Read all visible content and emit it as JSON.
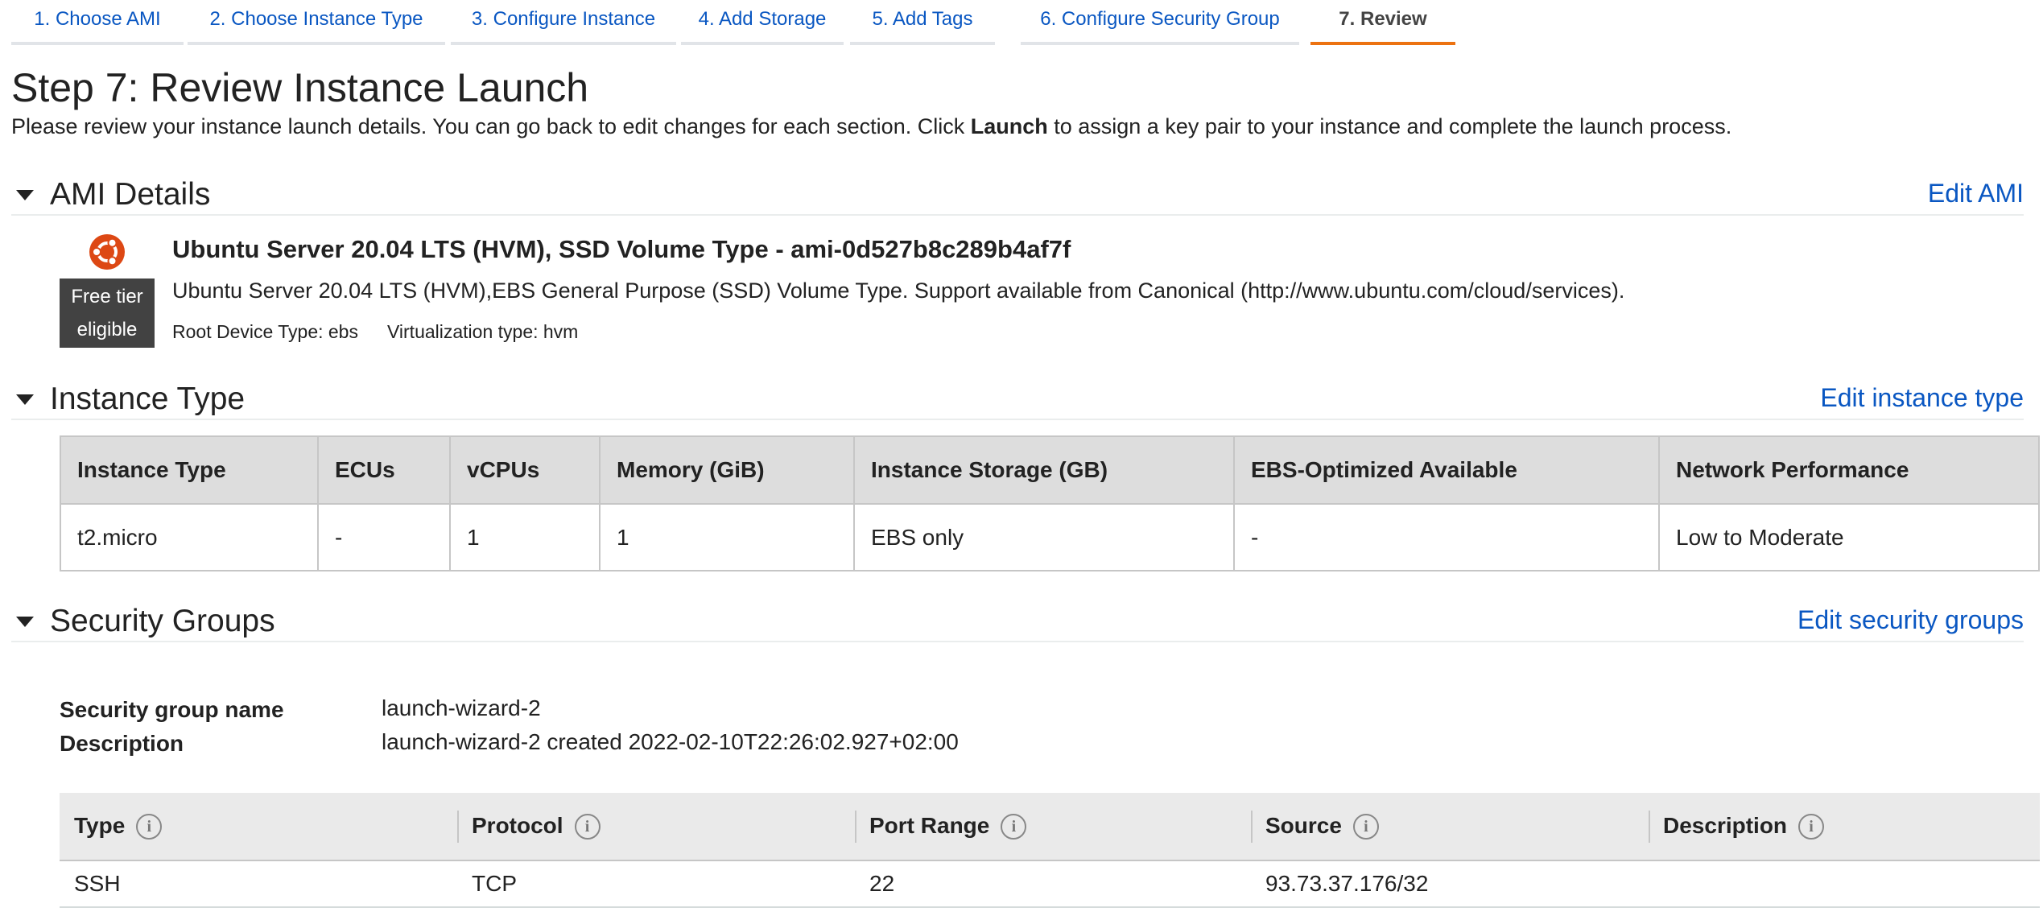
{
  "tabs": [
    {
      "label": "1. Choose AMI"
    },
    {
      "label": "2. Choose Instance Type"
    },
    {
      "label": "3. Configure Instance"
    },
    {
      "label": "4. Add Storage"
    },
    {
      "label": "5. Add Tags"
    },
    {
      "label": "6. Configure Security Group"
    },
    {
      "label": "7. Review",
      "active": true
    }
  ],
  "page": {
    "title": "Step 7: Review Instance Launch",
    "intro_before": "Please review your instance launch details. You can go back to edit changes for each section. Click ",
    "intro_bold": "Launch",
    "intro_after": " to assign a key pair to your instance and complete the launch process."
  },
  "ami": {
    "section_title": "AMI Details",
    "edit_label": "Edit AMI",
    "logo_icon": "ubuntu-logo-icon",
    "badge_line1": "Free tier",
    "badge_line2": "eligible",
    "name": "Ubuntu Server 20.04 LTS (HVM), SSD Volume Type - ami-0d527b8c289b4af7f",
    "description": "Ubuntu Server 20.04 LTS (HVM),EBS General Purpose (SSD) Volume Type. Support available from Canonical (http://www.ubuntu.com/cloud/services).",
    "root_device": "Root Device Type: ebs",
    "virtualization": "Virtualization type: hvm"
  },
  "instance_type": {
    "section_title": "Instance Type",
    "edit_label": "Edit instance type",
    "columns": [
      "Instance Type",
      "ECUs",
      "vCPUs",
      "Memory (GiB)",
      "Instance Storage (GB)",
      "EBS-Optimized Available",
      "Network Performance"
    ],
    "row": [
      "t2.micro",
      "-",
      "1",
      "1",
      "EBS only",
      "-",
      "Low to Moderate"
    ]
  },
  "security_groups": {
    "section_title": "Security Groups",
    "edit_label": "Edit security groups",
    "name_label": "Security group name",
    "name_value": "launch-wizard-2",
    "desc_label": "Description",
    "desc_value": "launch-wizard-2 created 2022-02-10T22:26:02.927+02:00",
    "columns": [
      "Type",
      "Protocol",
      "Port Range",
      "Source",
      "Description"
    ],
    "info_icon_glyph": "i",
    "rows": [
      [
        "SSH",
        "TCP",
        "22",
        "93.73.37.176/32",
        ""
      ]
    ]
  },
  "colors": {
    "link": "#0a57c2",
    "active_tab_underline": "#ec7211",
    "badge_bg": "#424242",
    "ubuntu_orange": "#dd4814"
  }
}
